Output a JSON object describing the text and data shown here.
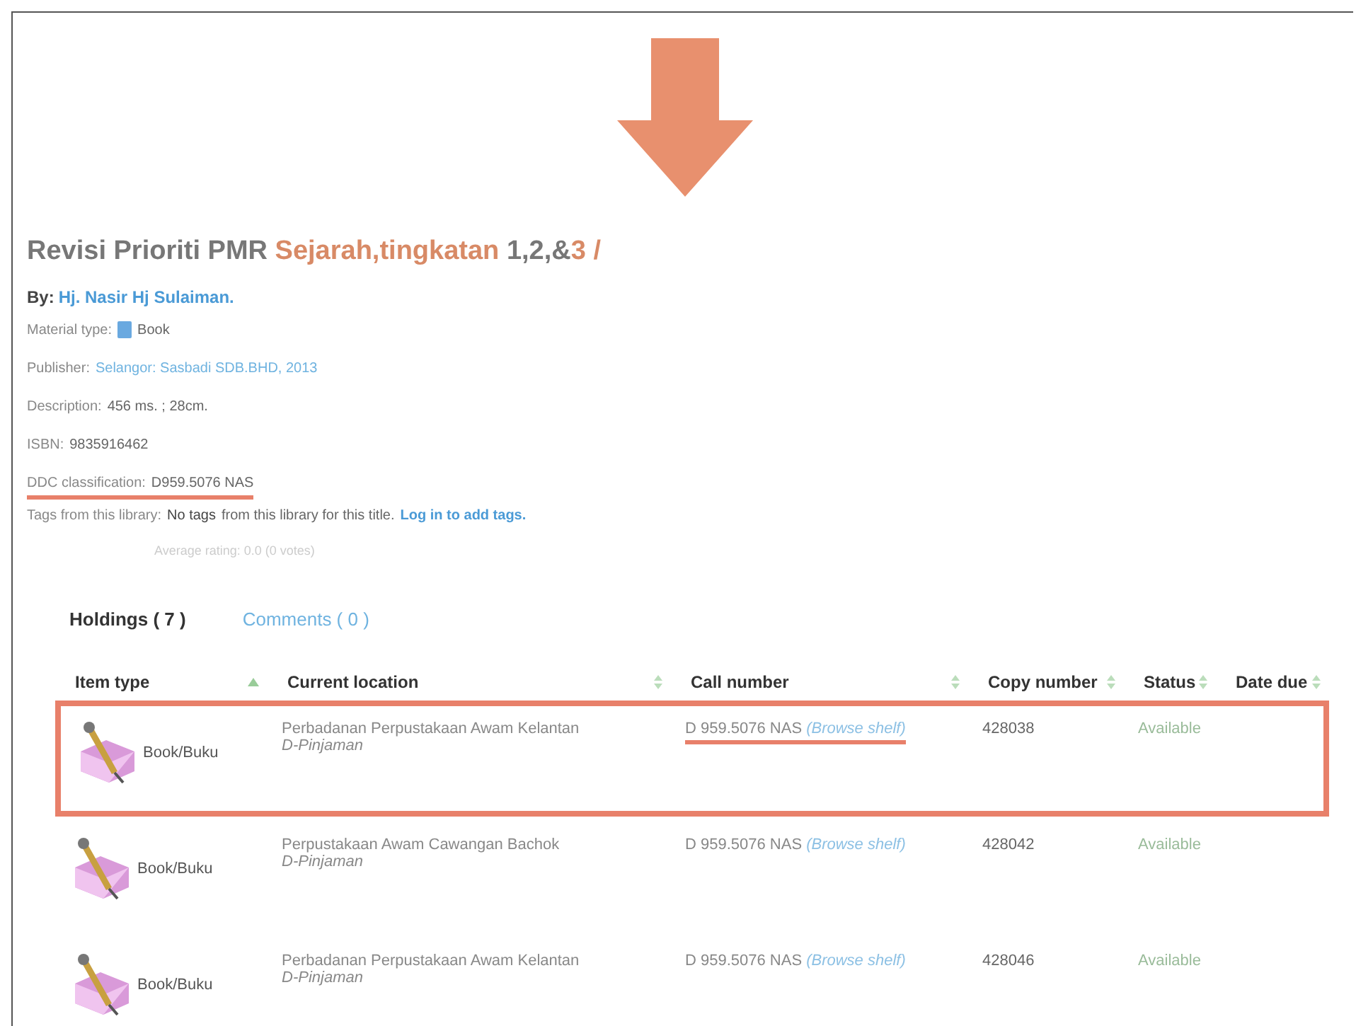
{
  "title_parts": [
    {
      "text": "Revisi Prioriti PMR ",
      "highlight": false
    },
    {
      "text": "Sejarah,tingkatan ",
      "highlight": true
    },
    {
      "text": "1,2,&",
      "highlight": false
    },
    {
      "text": "3 /",
      "highlight": true
    }
  ],
  "author": {
    "label": "By:",
    "name": "Hj. Nasir Hj Sulaiman."
  },
  "fields": [
    {
      "label": "Material type:",
      "value": "Book",
      "kind": "material",
      "underlined": false
    },
    {
      "label": "Publisher:",
      "value": "Selangor: Sasbadi SDB.BHD, 2013",
      "kind": "link",
      "underlined": false
    },
    {
      "label": "Description:",
      "value": "456 ms. ; 28cm.",
      "kind": "text",
      "underlined": false
    },
    {
      "label": "ISBN:",
      "value": "9835916462",
      "kind": "text",
      "underlined": false
    },
    {
      "label": "DDC classification:",
      "value": "D959.5076 NAS",
      "kind": "text",
      "underlined": true
    }
  ],
  "tags": {
    "label": "Tags from this library:",
    "value": "No tags",
    "note": "from this library for this title.",
    "link": "Log in to add tags."
  },
  "rating": "Average rating: 0.0 (0 votes)",
  "tabs": [
    {
      "label": "Holdings ( 7 )",
      "selected": true
    },
    {
      "label": "Comments ( 0 )",
      "selected": false
    }
  ],
  "columns": [
    {
      "label": "Item type",
      "sorted": true
    },
    {
      "label": "Current location",
      "sorted": false
    },
    {
      "label": "Call number",
      "sorted": false
    },
    {
      "label": "Copy number",
      "sorted": false
    },
    {
      "label": "Status",
      "sorted": false
    },
    {
      "label": "Date due",
      "sorted": false
    }
  ],
  "rows": [
    {
      "item_type": "Book/Buku",
      "location": "Perbadanan Perpustakaan Awam Kelantan",
      "sublocation": "D-Pinjaman",
      "call_number": "D 959.5076 NAS",
      "browse": "(Browse shelf)",
      "copy": "428038",
      "status": "Available",
      "highlighted": true
    },
    {
      "item_type": "Book/Buku",
      "location": "Perpustakaan Awam Cawangan Bachok",
      "sublocation": "D-Pinjaman",
      "call_number": "D 959.5076 NAS",
      "browse": "(Browse shelf)",
      "copy": "428042",
      "status": "Available",
      "highlighted": false
    },
    {
      "item_type": "Book/Buku",
      "location": "Perbadanan Perpustakaan Awam Kelantan",
      "sublocation": "D-Pinjaman",
      "call_number": "D 959.5076 NAS",
      "browse": "(Browse shelf)",
      "copy": "428046",
      "status": "Available",
      "highlighted": false
    }
  ]
}
